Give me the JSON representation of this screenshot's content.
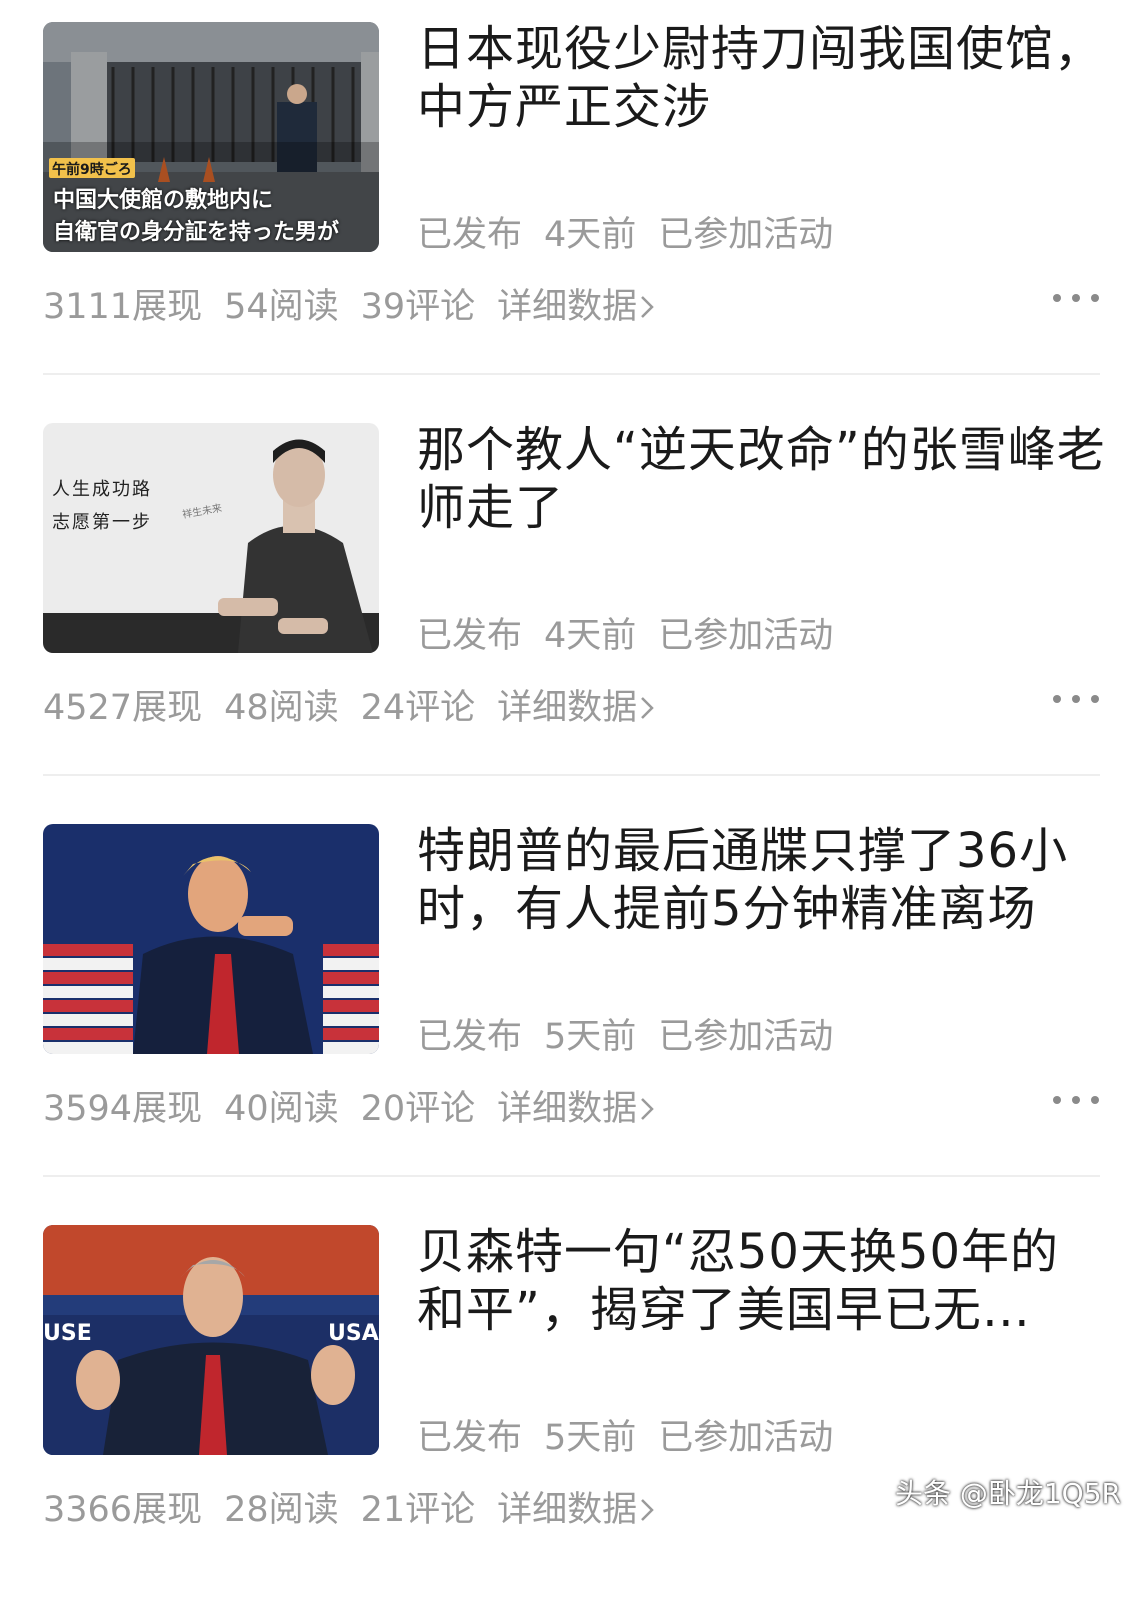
{
  "articles": [
    {
      "title": "日本现役少尉持刀闯我国使馆，中方严正交涉",
      "status": "已发布",
      "time": "4天前",
      "activity": "已参加活动",
      "impressions": "3111展现",
      "reads": "54阅读",
      "comments": "39评论",
      "detail": "详细数据",
      "thumb_caption_tag": "午前9時ごろ",
      "thumb_caption_line1": "中国大使館の敷地内に",
      "thumb_caption_line2": "自衛官の身分証を持った男が"
    },
    {
      "title": "那个教人“逆天改命”的张雪峰老师走了",
      "status": "已发布",
      "time": "4天前",
      "activity": "已参加活动",
      "impressions": "4527展现",
      "reads": "48阅读",
      "comments": "24评论",
      "detail": "详细数据",
      "thumb_text_line1": "人生成功路",
      "thumb_text_line2": "志愿第一步"
    },
    {
      "title": "特朗普的最后通牒只撑了36小时，有人提前5分钟精准离场",
      "status": "已发布",
      "time": "5天前",
      "activity": "已参加活动",
      "impressions": "3594展现",
      "reads": "40阅读",
      "comments": "20评论",
      "detail": "详细数据"
    },
    {
      "title": "贝森特一句“忍50天换50年的和平”，揭穿了美国早已无…",
      "status": "已发布",
      "time": "5天前",
      "activity": "已参加活动",
      "impressions": "3366展现",
      "reads": "28阅读",
      "comments": "21评论",
      "detail": "详细数据",
      "thumb_sign_left": "USE",
      "thumb_sign_right": "USA"
    }
  ],
  "watermark": "头条 @卧龙1Q5R",
  "icons": {
    "more": "more-dots-icon",
    "chevron": "chevron-right-icon"
  }
}
